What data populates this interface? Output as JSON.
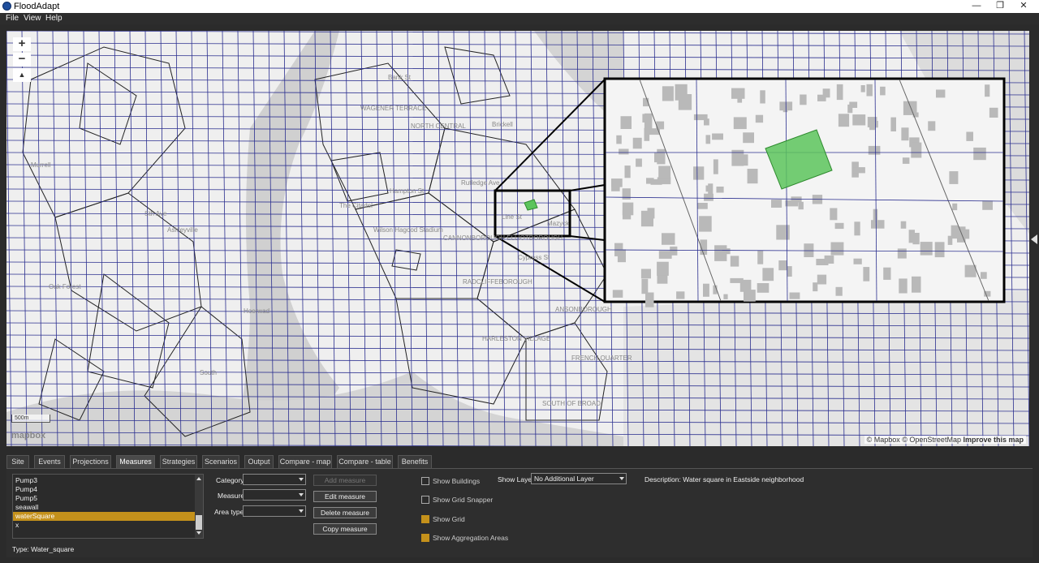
{
  "window": {
    "title": "FloodAdapt",
    "controls": [
      "—",
      "❐",
      "✕"
    ]
  },
  "menu": [
    "File",
    "View",
    "Help"
  ],
  "map": {
    "zoom_in": "+",
    "zoom_out": "−",
    "compass": "▲",
    "scale": "500m",
    "logo": "mapbox",
    "attribution": {
      "mapbox": "© Mapbox",
      "osm": "© OpenStreetMap",
      "improve": "Improve this map"
    },
    "place_labels": [
      "Ashleyville",
      "Hoerwad",
      "Oak Forest",
      "South",
      "Brickell",
      "Murrell",
      "Sth Ave",
      "The Citadel",
      "Wilson Hagood Stadium",
      "CANNONBOROUGH ELLIOTBOROUGH",
      "RADCLIFFEBOROUGH",
      "HARLESTON VILLAGE",
      "ANSONBOROUGH",
      "FRENCH QUARTER",
      "SOUTH OF BROAD",
      "WAGENER TERRACE",
      "NORTH CENTRAL",
      "Hampton St",
      "Rutledge Ave",
      "Line St",
      "Cypress St",
      "Mazyck",
      "Bank St"
    ]
  },
  "tabs": [
    "Site",
    "Events",
    "Projections",
    "Measures",
    "Strategies",
    "Scenarios",
    "Output",
    "Compare - map",
    "Compare - table",
    "Benefits"
  ],
  "active_tab": "Measures",
  "measures_list": {
    "items": [
      "Pump3",
      "Pump4",
      "Pump5",
      "seawall",
      "waterSquare",
      "x"
    ],
    "selected": "waterSquare"
  },
  "type_label": "Type: Water_square",
  "form": {
    "category_label": "Category",
    "measure_label": "Measure",
    "area_type_label": "Area type",
    "category_value": "",
    "measure_value": "",
    "area_type_value": ""
  },
  "buttons": {
    "add": "Add measure",
    "edit": "Edit measure",
    "delete": "Delete measure",
    "copy": "Copy measure"
  },
  "checkboxes": {
    "buildings": {
      "label": "Show Buildings",
      "checked": false
    },
    "grid_snapper": {
      "label": "Show Grid Snapper",
      "checked": false
    },
    "grid": {
      "label": "Show Grid",
      "checked": true
    },
    "aggregation": {
      "label": "Show Aggregation Areas",
      "checked": true
    }
  },
  "show_layer": {
    "label": "Show Layer",
    "value": "No Additional Layer"
  },
  "description": "Description: Water square in Eastside neighborhood",
  "colors": {
    "accent": "#c4911b",
    "grid": "#2b2f8f",
    "measure_polygon": "#5cc45c",
    "water": "#c8c8c8"
  }
}
